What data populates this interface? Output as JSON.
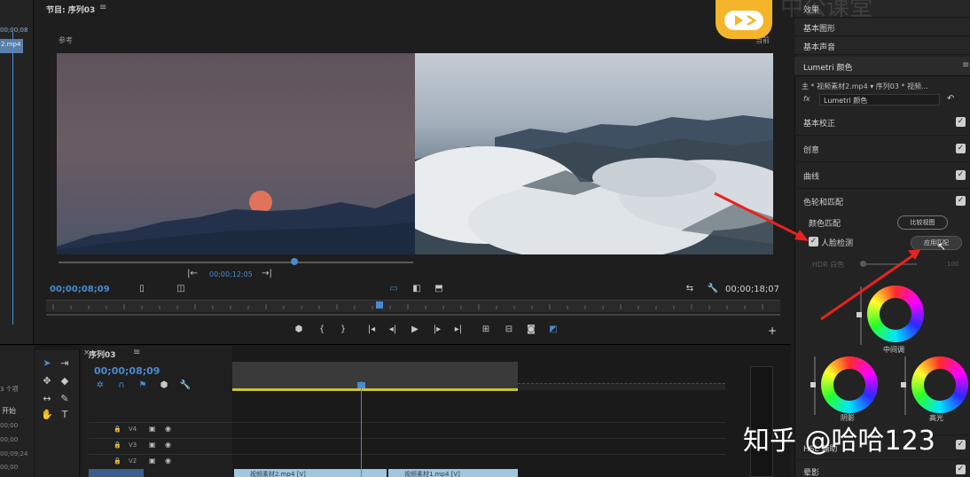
{
  "left_panel": {
    "timecode": "00;00;08",
    "clip_label": "2.mp4",
    "items_count": "3 个项",
    "start_label": "开始",
    "tc_a": "00;00",
    "tc_b": "00;00",
    "tc_c": "00;00",
    "tc_d": "00;09;24"
  },
  "program_monitor": {
    "title": "节目: 序列03",
    "menu_icon": "≡",
    "reference_label": "参考",
    "current_label": "当前",
    "reference_timecode": "00;00;12;05",
    "current_timecode": "00;00;08;09",
    "duration": "00;00;18;07",
    "ref_controls": [
      "|←",
      "→|"
    ]
  },
  "timeline": {
    "close_icon": "×",
    "sequence_tab": "序列03",
    "menu_icon": "≡",
    "timecode": "00;00;08;09",
    "tracks": [
      {
        "name": "V4"
      },
      {
        "name": "V3"
      },
      {
        "name": "V2"
      }
    ],
    "clip_a": "视频素材2.mp4 [V]",
    "clip_b": "视频素材1.mp4 [V]"
  },
  "right_panel": {
    "top_items": [
      "效果",
      "基本图形",
      "基本声音"
    ],
    "lumetri_title": "Lumetri 颜色",
    "menu_icon": "≡",
    "source_line": "主 * 视频素材2.mp4  ▾  序列03 * 视频...",
    "fx_label": "fx",
    "fx_select": "Lumetri 颜色",
    "sections": [
      "基本校正",
      "创意",
      "曲线",
      "色轮和匹配"
    ],
    "color_match_label": "颜色匹配",
    "compare_button": "比较视图",
    "face_detect_label": "人脸检测",
    "apply_button": "应用匹配",
    "hdr_label": "HDR 白色",
    "hdr_value": "100",
    "wheel_midtones": "中间调",
    "wheel_shadows": "阴影",
    "wheel_highlights": "高光",
    "hsl_label": "HSL 辅助",
    "vignette_label": "晕影"
  },
  "overlay": {
    "watermark": "知乎 @哈哈123",
    "logo_text": "中公课堂"
  },
  "colors": {
    "accent_blue": "#4a8ad0",
    "annotation_red": "#e8231f",
    "clip_blue": "#9fc7e0",
    "logo_yellow": "#f4b52a"
  }
}
